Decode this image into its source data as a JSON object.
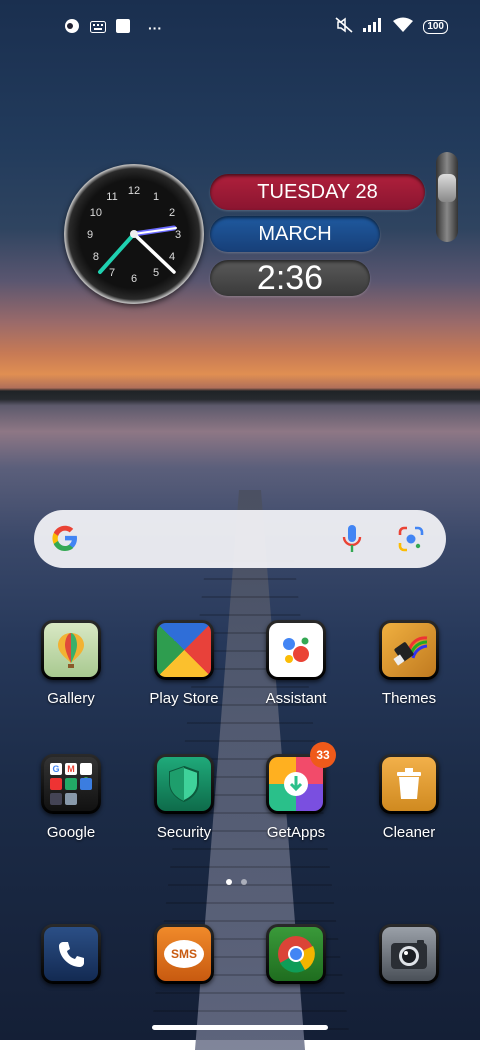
{
  "status_bar": {
    "icons_left": [
      "app-indicator-icon",
      "keyboard-icon",
      "square-notification-icon"
    ],
    "more": "···",
    "icons_right": [
      "mute-icon",
      "signal-icon",
      "wifi-icon"
    ],
    "battery": "100"
  },
  "clock_widget": {
    "day": "TUESDAY 28",
    "month": "MARCH",
    "time": "2:36",
    "dial_numbers": [
      "12",
      "1",
      "2",
      "3",
      "4",
      "5",
      "6",
      "7",
      "8",
      "9",
      "10",
      "11"
    ],
    "colors": {
      "day_bar": "#a81c38",
      "month_bar": "#1c4f90",
      "time_bar": "#4a4a4a",
      "second_hand": "#1fd0b0"
    }
  },
  "search": {
    "logo": "G",
    "icons": [
      "google-g-icon",
      "microphone-icon",
      "google-lens-icon"
    ]
  },
  "apps_row1": [
    {
      "label": "Gallery",
      "icon": "balloon-icon"
    },
    {
      "label": "Play Store",
      "icon": "play-store-icon"
    },
    {
      "label": "Assistant",
      "icon": "assistant-dots-icon"
    },
    {
      "label": "Themes",
      "icon": "paintbrush-icon"
    }
  ],
  "apps_row2": [
    {
      "label": "Google",
      "icon": "folder-icon"
    },
    {
      "label": "Security",
      "icon": "shield-icon"
    },
    {
      "label": "GetApps",
      "icon": "download-icon",
      "badge": "33"
    },
    {
      "label": "Cleaner",
      "icon": "trash-icon"
    }
  ],
  "dock": [
    {
      "icon": "phone-icon"
    },
    {
      "icon": "sms-icon",
      "text": "SMS"
    },
    {
      "icon": "chrome-icon"
    },
    {
      "icon": "camera-icon"
    }
  ],
  "page_indicator": {
    "pages": 2,
    "active": 1
  }
}
